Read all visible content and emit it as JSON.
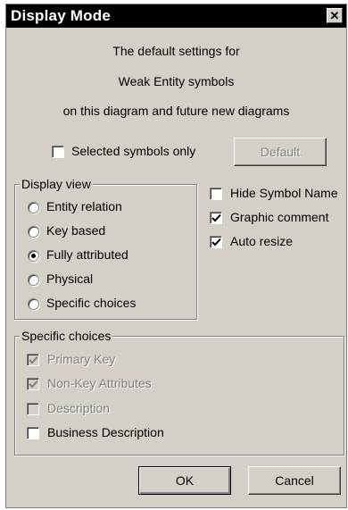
{
  "window": {
    "title": "Display Mode",
    "close_glyph": "✕"
  },
  "message": {
    "line1": "The default settings for",
    "line2": "Weak Entity symbols",
    "line3": "on this diagram and future new diagrams"
  },
  "selected_only": {
    "label": "Selected symbols only",
    "checked": false
  },
  "default_button": {
    "label": "Default",
    "enabled": false
  },
  "display_view": {
    "title": "Display view",
    "options": [
      {
        "label": "Entity relation",
        "selected": false
      },
      {
        "label": "Key based",
        "selected": false
      },
      {
        "label": "Fully attributed",
        "selected": true
      },
      {
        "label": "Physical",
        "selected": false
      },
      {
        "label": "Specific choices",
        "selected": false
      }
    ]
  },
  "options": [
    {
      "label": "Hide Symbol Name",
      "checked": false
    },
    {
      "label": "Graphic comment",
      "checked": true
    },
    {
      "label": "Auto resize",
      "checked": true
    }
  ],
  "specific_choices": {
    "title": "Specific choices",
    "items": [
      {
        "label": "Primary Key",
        "checked": true,
        "enabled": false
      },
      {
        "label": "Non-Key Attributes",
        "checked": true,
        "enabled": false
      },
      {
        "label": "Description",
        "checked": false,
        "enabled": false
      },
      {
        "label": "Business Description",
        "checked": false,
        "enabled": true
      }
    ]
  },
  "buttons": {
    "ok": "OK",
    "cancel": "Cancel"
  }
}
